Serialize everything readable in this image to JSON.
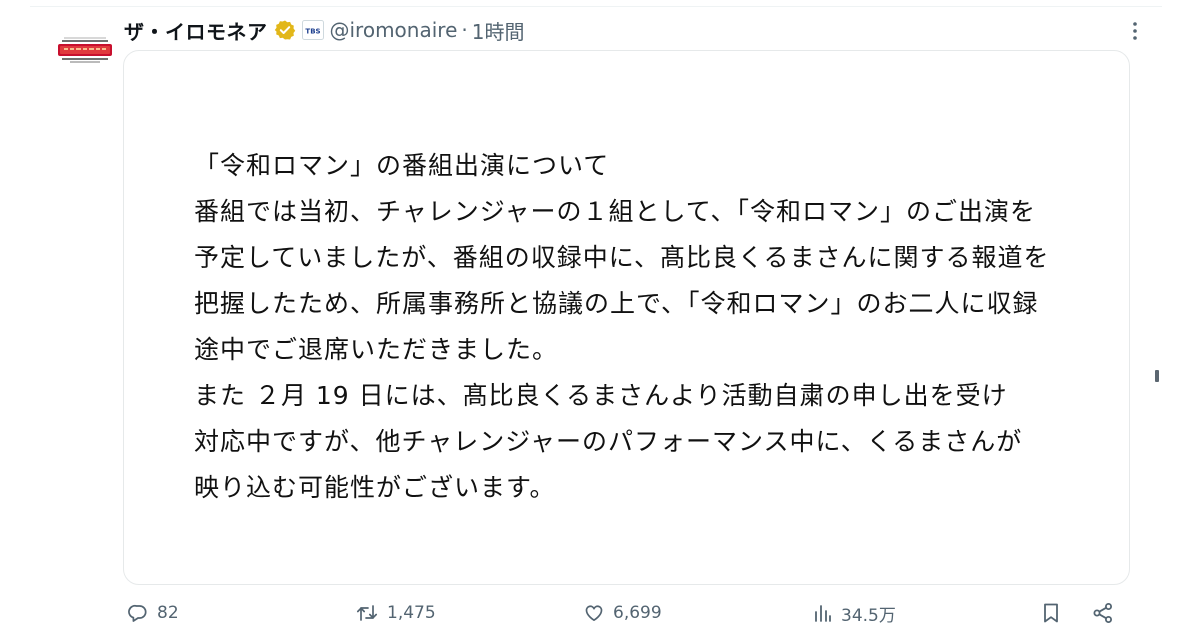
{
  "tweet": {
    "display_name": "ザ・イロモネア",
    "handle": "@iromonaire",
    "separator": "·",
    "time": "1時間",
    "affiliate_badge_text": "TBS",
    "verified_color": "#e2b719",
    "avatar_logo_text": "ザ・イロモネア",
    "statement_lines": [
      "「令和ロマン」の番組出演について",
      "番組では当初、チャレンジャーの１組として、「令和ロマン」のご出演を",
      "予定していましたが、番組の収録中に、髙比良くるまさんに関する報道を",
      "把握したため、所属事務所と協議の上で、「令和ロマン」のお二人に収録",
      "途中でご退席いただきました。",
      "また ２月 19 日には、髙比良くるまさんより活動自粛の申し出を受け",
      "対応中ですが、他チャレンジャーのパフォーマンス中に、くるまさんが",
      "映り込む可能性がございます。"
    ]
  },
  "actions": {
    "replies": "82",
    "reposts": "1,475",
    "likes": "6,699",
    "views": "34.5万"
  },
  "icons": {
    "reply": "reply-icon",
    "repost": "repost-icon",
    "like": "like-icon",
    "views": "views-icon",
    "bookmark": "bookmark-icon",
    "share": "share-icon",
    "more": "more-vertical-icon",
    "verified": "verified-badge-icon"
  },
  "colors": {
    "text": "#0f1419",
    "secondary": "#536471",
    "card_border": "#e6e9ea",
    "verified": "#e2b719",
    "logo_red": "#c8102e"
  }
}
